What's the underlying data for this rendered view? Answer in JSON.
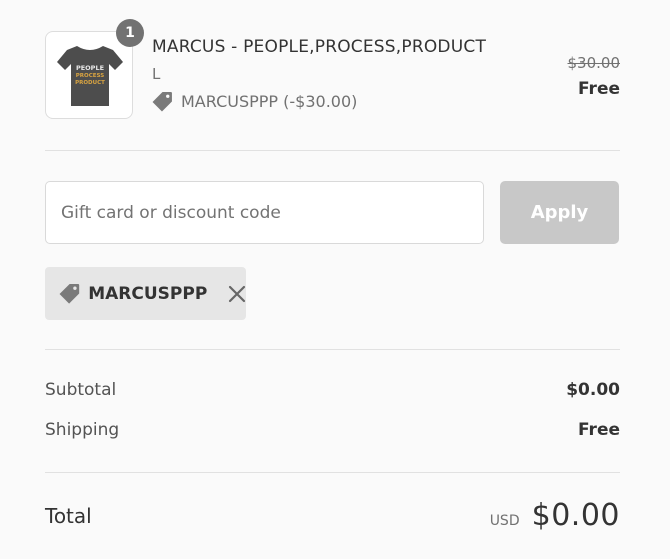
{
  "cart": {
    "item": {
      "quantity": "1",
      "name": "MARCUS - PEOPLE,PROCESS,PRODUCT",
      "variant": "L",
      "discount_line": "MARCUSPPP (-$30.00)",
      "original_price": "$30.00",
      "final_price": "Free",
      "thumbnail_text": [
        "PEOPLE",
        "PROCESS",
        "PRODUCT"
      ]
    }
  },
  "discount": {
    "placeholder": "Gift card or discount code",
    "value": "",
    "apply_label": "Apply",
    "applied_code": "MARCUSPPP"
  },
  "summary": {
    "subtotal_label": "Subtotal",
    "subtotal_value": "$0.00",
    "shipping_label": "Shipping",
    "shipping_value": "Free",
    "total_label": "Total",
    "currency": "USD",
    "total_value": "$0.00"
  },
  "colors": {
    "badge": "#727272",
    "apply_button_disabled": "#c8c8c8",
    "chip_background": "#e6e6e6",
    "tag_icon": "#7a7a7a"
  },
  "icons": {
    "discount_tag": "tag-icon",
    "remove": "close-icon"
  }
}
